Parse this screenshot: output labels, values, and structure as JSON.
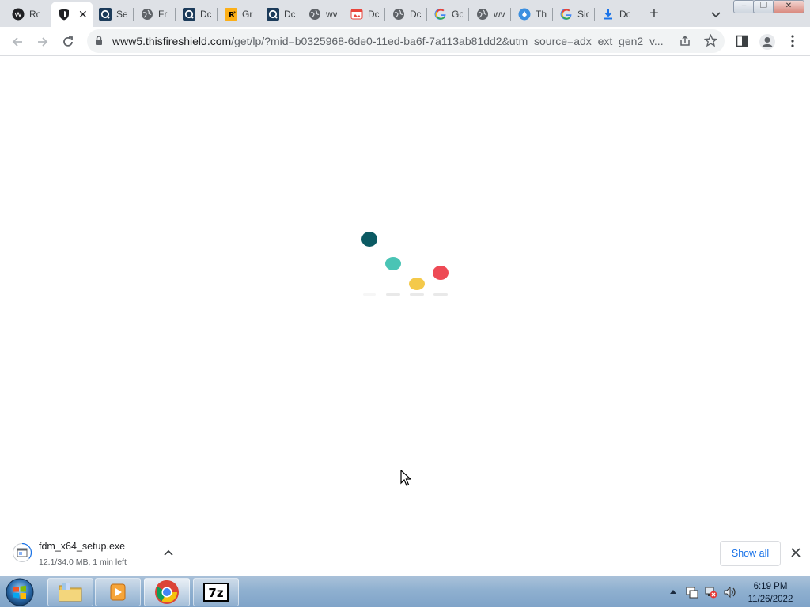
{
  "tabs": [
    {
      "label": "Ro",
      "icon": "dark-circle-icon"
    },
    {
      "label": "",
      "icon": "shield-icon",
      "active": true
    },
    {
      "label": "Se",
      "icon": "q-logo-icon"
    },
    {
      "label": "Fr",
      "icon": "globe-icon"
    },
    {
      "label": "Dc",
      "icon": "q-logo-icon"
    },
    {
      "label": "Gr",
      "icon": "rockstar-icon"
    },
    {
      "label": "Dc",
      "icon": "q-logo-icon"
    },
    {
      "label": "wv",
      "icon": "globe-icon"
    },
    {
      "label": "Dc",
      "icon": "image-icon"
    },
    {
      "label": "Dc",
      "icon": "globe-icon"
    },
    {
      "label": "Gc",
      "icon": "google-icon"
    },
    {
      "label": "wv",
      "icon": "globe-icon"
    },
    {
      "label": "Th",
      "icon": "blue-badge-icon"
    },
    {
      "label": "Sic",
      "icon": "google-icon"
    },
    {
      "label": "Dc",
      "icon": "download-icon"
    }
  ],
  "window": {
    "minimize": "–",
    "restore": "❐",
    "close": "✕"
  },
  "toolbar": {
    "url_host": "www5.thisfireshield.com",
    "url_rest": "/get/lp/?mid=b0325968-6de0-11ed-ba6f-7a113ab81dd2&utm_source=adx_ext_gen2_v..."
  },
  "loader": {
    "colors": [
      "#0b5a63",
      "#4ac4b5",
      "#f4c94a",
      "#ee4a55"
    ]
  },
  "download": {
    "filename": "fdm_x64_setup.exe",
    "status": "12.1/34.0 MB, 1 min left",
    "show_all_label": "Show all"
  },
  "taskbar": {
    "time": "6:19 PM",
    "date": "11/26/2022"
  }
}
